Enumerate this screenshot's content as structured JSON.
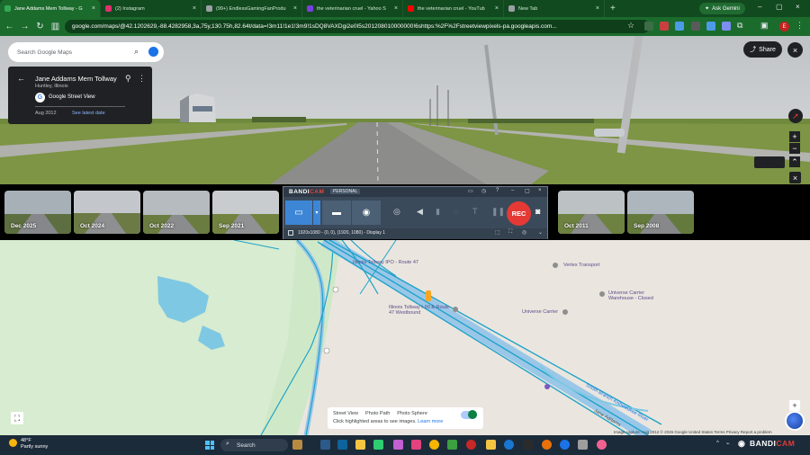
{
  "browser": {
    "tabs": [
      {
        "title": "Jane Addams Mem Tollway - G",
        "color": "#34a853",
        "active": true
      },
      {
        "title": "(2) Instagram",
        "color": "#e1306c",
        "active": false
      },
      {
        "title": "(99+) EndlessGamingFanProdu",
        "color": "#9aa0a6",
        "active": false
      },
      {
        "title": "the veterinarian cruel - Yahoo S",
        "color": "#7b3fe4",
        "active": false
      },
      {
        "title": "the veterinarian cruel - YouTub",
        "color": "#ff0000",
        "active": false
      },
      {
        "title": "New Tab",
        "color": "#9aa0a6",
        "active": false
      }
    ],
    "new_tab_glyph": "+",
    "ask_gemini": "Ask Gemini",
    "url_prefix": "google.com",
    "url": "/maps/@42.1202629,-88.4282958,3a,75y,130.75h,82.64t/data=!3m11!1e1!3m9!1sDQ8VAXDgi2e0I5s201208010000000!6shttps:%2F%2Fstreetviewpixels-pa.googleapis.com...",
    "profile_initial": "E"
  },
  "streetview": {
    "search_placeholder": "Search Google Maps",
    "card": {
      "title": "Jane Addams Mem Tollway",
      "subtitle": "Huntley, Illinois",
      "brand": "Google Street View",
      "date": "Aug 2012",
      "see_latest": "See latest date"
    },
    "share_label": "Share",
    "road_text": "Jane Addams Tollway"
  },
  "timeline": [
    {
      "label": "Dec 2025"
    },
    {
      "label": "Oct 2024"
    },
    {
      "label": "Oct 2022"
    },
    {
      "label": "Sep 2021"
    },
    {
      "label": "Oct 2011"
    },
    {
      "label": "Sep 2008"
    }
  ],
  "bandicam": {
    "logo_a": "BANDI",
    "logo_b": "CAM",
    "edition": "PERSONAL",
    "rec_label": "REC",
    "resolution": "1920x1080 - (0, 0), (1920, 1080) - Display 1"
  },
  "map": {
    "labels": [
      "Illinois Tollway IPO - Route 47",
      "Vertex Transport",
      "Universe Carrier Warehouse - Closed",
      "Universe Carrier",
      "Illinois Tollway I-90 & Route 47 Westbound",
      "South Branch Kishwaukee River",
      "Jane Addams"
    ],
    "legend": {
      "street_view": "Street View",
      "photo_path": "Photo Path",
      "photo_sphere": "Photo Sphere",
      "hint": "Click highlighted areas to see images.",
      "learn_more": "Learn more"
    },
    "attribution": "Image capture: Aug 2012  © 2026 Google   United States   Terms   Privacy   Report a problem"
  },
  "taskbar": {
    "temp": "48°F",
    "condition": "Partly sunny",
    "search_label": "Search",
    "watermark_a": "BANDI",
    "watermark_b": "CAM"
  }
}
